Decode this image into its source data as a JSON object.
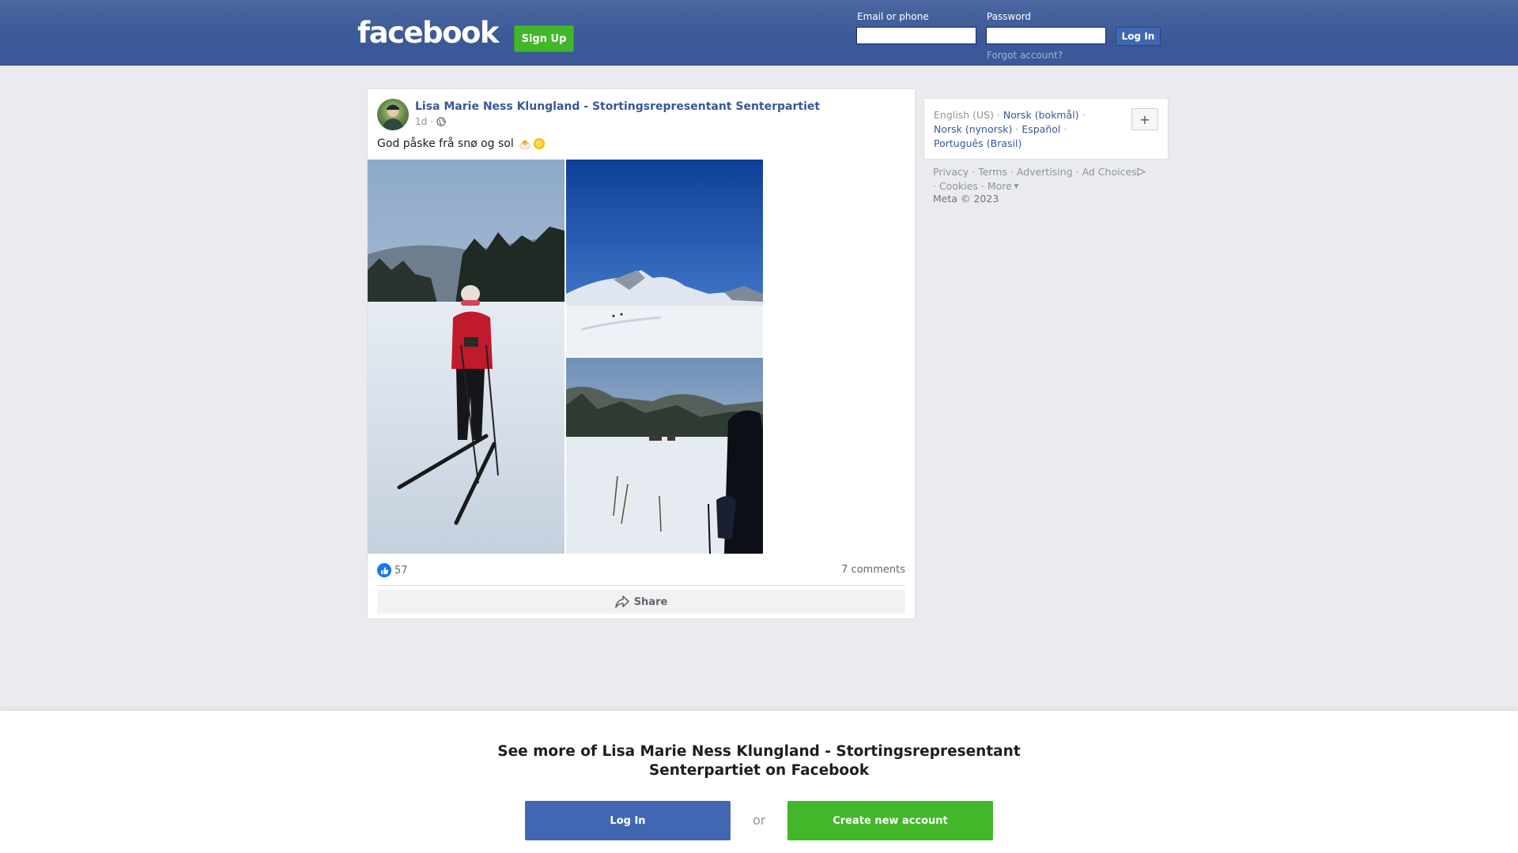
{
  "header": {
    "logo_text": "facebook",
    "signup_label": "Sign Up",
    "email_label": "Email or phone",
    "password_label": "Password",
    "login_label": "Log In",
    "forgot_label": "Forgot account?"
  },
  "post": {
    "author": "Lisa Marie Ness Klungland - Stortingsrepresentant Senterpartiet",
    "time": "1d",
    "time_separator": "·",
    "audience_icon": "globe-icon",
    "text": "God påske frå snø og sol",
    "emojis": [
      "hatching-chick-emoji",
      "sun-emoji"
    ],
    "photos": [
      "skier-standing-in-snow-photo",
      "snowy-mountain-blue-sky-photo",
      "snowy-valley-cabins-photo"
    ],
    "reaction_count": "57",
    "reaction_icon": "like-icon",
    "comments_label": "7 comments",
    "share_label": "Share"
  },
  "sidebar": {
    "languages": [
      {
        "label": "English (US)",
        "current": true
      },
      {
        "label": "Norsk (bokmål)"
      },
      {
        "label": "Norsk (nynorsk)"
      },
      {
        "label": "Español"
      },
      {
        "label": "Português (Brasil)"
      }
    ],
    "plus_label": "+",
    "footer_links": [
      "Privacy",
      "Terms",
      "Advertising",
      "Ad Choices",
      "Cookies",
      "More"
    ],
    "copyright": "Meta © 2023"
  },
  "banner": {
    "title": "See more of Lisa Marie Ness Klungland - Stortingsrepresentant Senterpartiet on Facebook",
    "login_label": "Log In",
    "or_label": "or",
    "create_label": "Create new account"
  },
  "colors": {
    "brand_blue": "#3b5998",
    "link_blue": "#385898",
    "signup_green": "#42b72a",
    "like_blue": "#1877f2"
  }
}
